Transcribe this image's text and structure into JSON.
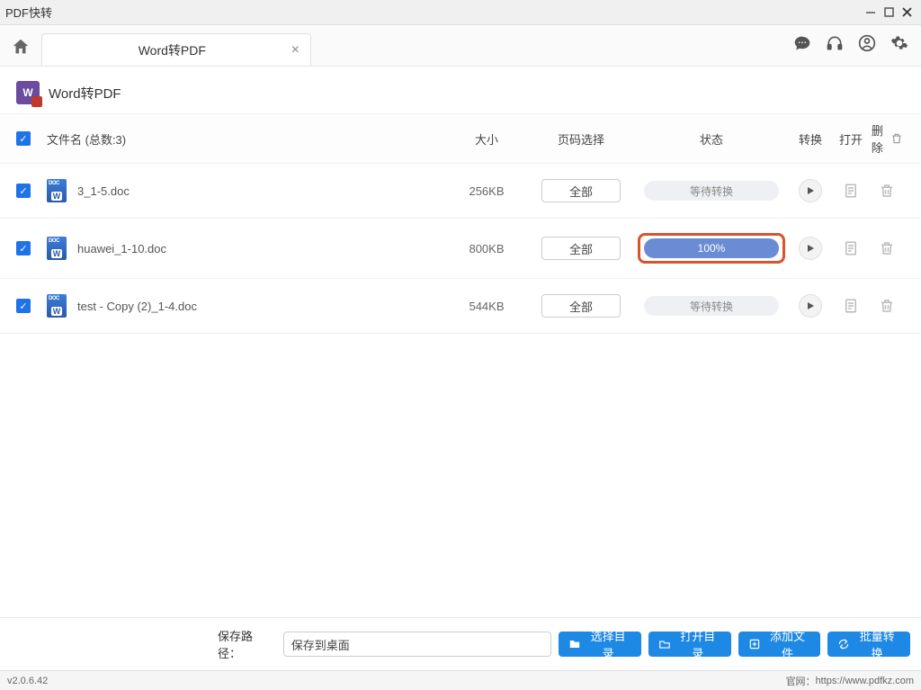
{
  "app_title": "PDF快转",
  "tab": {
    "title": "Word转PDF"
  },
  "page": {
    "title": "Word转PDF"
  },
  "table": {
    "header": {
      "filename": "文件名 (总数:3)",
      "size": "大小",
      "pages": "页码选择",
      "status": "状态",
      "convert": "转换",
      "open": "打开",
      "delete": "删除"
    },
    "rows": [
      {
        "name": "3_1-5.doc",
        "size": "256KB",
        "page_sel": "全部",
        "status_text": "等待转换",
        "done": false,
        "highlight": false
      },
      {
        "name": "huawei_1-10.doc",
        "size": "800KB",
        "page_sel": "全部",
        "status_text": "100%",
        "done": true,
        "highlight": true
      },
      {
        "name": "test - Copy (2)_1-4.doc",
        "size": "544KB",
        "page_sel": "全部",
        "status_text": "等待转换",
        "done": false,
        "highlight": false
      }
    ]
  },
  "bottom": {
    "path_label": "保存路径：",
    "path_value": "保存到桌面",
    "choose_dir": "选择目录",
    "open_dir": "打开目录",
    "add_file": "添加文件",
    "batch": "批量转换"
  },
  "status": {
    "version": "v2.0.6.42",
    "site_label": "官网：",
    "site_url": "https://www.pdfkz.com"
  }
}
